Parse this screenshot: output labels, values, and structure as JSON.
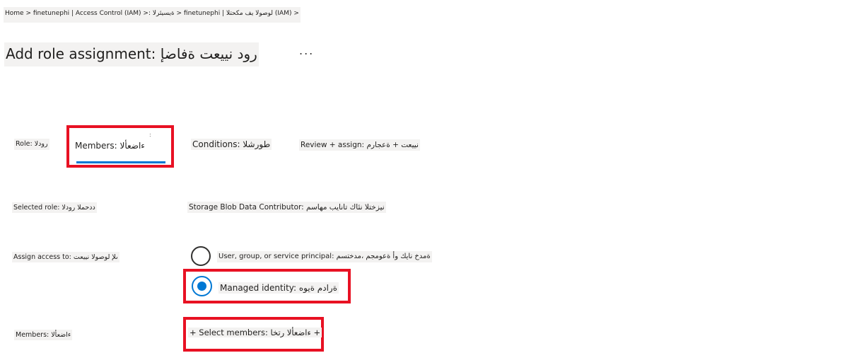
{
  "breadcrumb": "Home > finetunephi | Access Control (IAM) >: ةيسيئرلا > finetunephi | لوصولا يف مكحتلا (IAM) >",
  "page_title": "Add role assignment: رود نييعت ةفاضإ",
  "more_label": "...",
  "tabs": {
    "role": "Role: رودلا",
    "members": "Members: ءاضعألا",
    "members_dot": ":",
    "conditions": "Conditions: طورشلا",
    "review": "Review + assign: نييعت + ةعجارم"
  },
  "form": {
    "selected_role_label": "Selected role: ددحملا رودلا",
    "selected_role_value": "Storage Blob Data Contributor: نيزختلا نئاك تانايب مهاسم",
    "assign_access_label": "Assign access to: ىلإ لوصولا نييعت",
    "option_user": "User, group, or service principal: ةمدخ نايك وأ ةعومجم ،مدختسم",
    "option_managed": "Managed identity: ةرادم ةيوه",
    "managed_selected": true,
    "members_label": "Members: ءاضعألا",
    "select_members": "+ Select members: ءاضعألا رتخا +"
  },
  "colors": {
    "highlight": "#e81123",
    "accent": "#0078d4",
    "label_bg": "#f3f2f1"
  }
}
